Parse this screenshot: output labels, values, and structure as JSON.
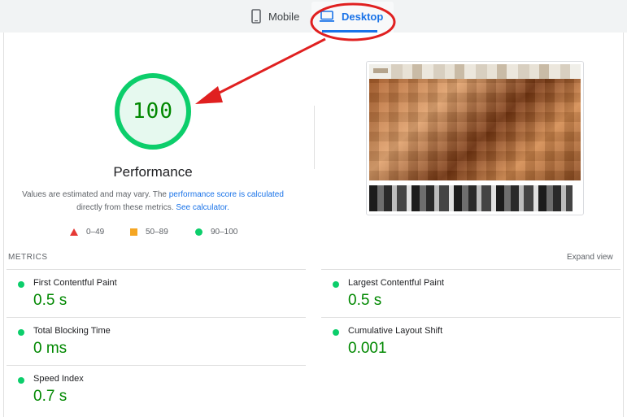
{
  "tabs": {
    "mobile_label": "Mobile",
    "desktop_label": "Desktop",
    "active": "Desktop"
  },
  "performance": {
    "score": "100",
    "score_fraction": 1.0,
    "title": "Performance",
    "note_prefix": "Values are estimated and may vary. The ",
    "note_link1": "performance score is calculated",
    "note_middle": " directly from these metrics. ",
    "note_link2": "See calculator.",
    "legend": {
      "fail": "0–49",
      "average": "50–89",
      "pass": "90–100"
    }
  },
  "metrics_section": {
    "label": "METRICS",
    "expand_label": "Expand view",
    "items": [
      {
        "name": "First Contentful Paint",
        "value": "0.5 s"
      },
      {
        "name": "Largest Contentful Paint",
        "value": "0.5 s"
      },
      {
        "name": "Total Blocking Time",
        "value": "0 ms"
      },
      {
        "name": "Cumulative Layout Shift",
        "value": "0.001"
      },
      {
        "name": "Speed Index",
        "value": "0.7 s"
      }
    ]
  },
  "colors": {
    "pass_green": "#0cce6b",
    "score_text": "#008800",
    "accent_blue": "#1a73e8",
    "fail_red": "#e53935",
    "average_orange": "#f5a623",
    "annotation_red": "#e02020"
  },
  "icons": {
    "mobile": "phone-icon",
    "desktop": "laptop-icon"
  }
}
